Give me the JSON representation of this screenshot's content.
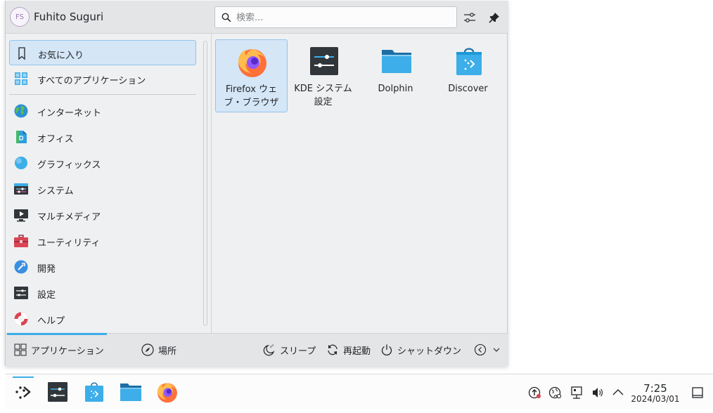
{
  "header": {
    "avatar_initials": "FS",
    "user_name": "Fuhito Suguri",
    "search_placeholder": "検索..."
  },
  "categories": [
    {
      "label": "お気に入り",
      "icon": "bookmark-icon",
      "selected": true
    },
    {
      "label": "すべてのアプリケーション",
      "icon": "grid-icon"
    },
    {
      "label": "インターネット",
      "icon": "globe-icon"
    },
    {
      "label": "オフィス",
      "icon": "office-icon"
    },
    {
      "label": "グラフィックス",
      "icon": "graphics-icon"
    },
    {
      "label": "システム",
      "icon": "system-icon"
    },
    {
      "label": "マルチメディア",
      "icon": "multimedia-icon"
    },
    {
      "label": "ユーティリティ",
      "icon": "toolbox-icon"
    },
    {
      "label": "開発",
      "icon": "development-icon"
    },
    {
      "label": "設定",
      "icon": "settings-icon"
    },
    {
      "label": "ヘルプ",
      "icon": "help-icon"
    }
  ],
  "favorites": [
    {
      "line1": "Firefox ウェ",
      "line2": "ブ・ブラウザ",
      "icon": "firefox-icon",
      "selected": true
    },
    {
      "line1": "KDE システム",
      "line2": "設定",
      "icon": "system-settings-icon"
    },
    {
      "line1": "Dolphin",
      "line2": "",
      "icon": "folder-icon"
    },
    {
      "line1": "Discover",
      "line2": "",
      "icon": "discover-icon"
    }
  ],
  "footer": {
    "applications_tab": "アプリケーション",
    "places_tab": "場所",
    "sleep": "スリープ",
    "restart": "再起動",
    "shutdown": "シャットダウン"
  },
  "panel": {
    "time": "7:25",
    "date": "2024/03/01"
  },
  "colors": {
    "accent": "#3daee9",
    "selection_bg": "#d5e6f7",
    "selection_border": "#93c3ec"
  }
}
